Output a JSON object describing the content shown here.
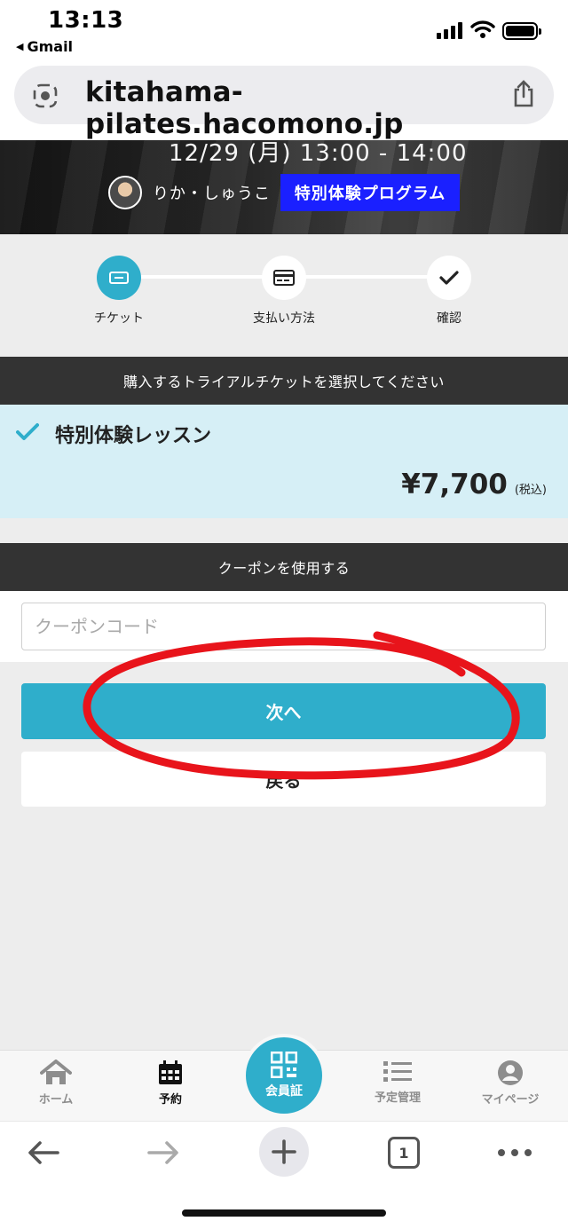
{
  "status_bar": {
    "time": "13:13",
    "back_app": "Gmail"
  },
  "browser": {
    "url": "kitahama-pilates.hacomono.jp",
    "tab_count": "1"
  },
  "lesson": {
    "datetime": "12/29 (月) 13:00 - 14:00",
    "instructor": "りか・しゅうこ",
    "program_badge": "特別体験プログラム"
  },
  "steps": [
    {
      "label": "チケット",
      "icon": "ticket-icon",
      "active": true
    },
    {
      "label": "支払い方法",
      "icon": "credit-card-icon",
      "active": false
    },
    {
      "label": "確認",
      "icon": "check-icon",
      "active": false
    }
  ],
  "ticket_section": {
    "header": "購入するトライアルチケットを選択してください",
    "ticket_name": "特別体験レッスン",
    "price": "¥7,700",
    "tax_note": "(税込)"
  },
  "coupon_section": {
    "header": "クーポンを使用する",
    "placeholder": "クーポンコード",
    "value": ""
  },
  "actions": {
    "next_label": "次へ",
    "back_label": "戻る"
  },
  "tab_bar": {
    "home": "ホーム",
    "reserve": "予約",
    "member_card": "会員証",
    "schedule": "予定管理",
    "mypage": "マイページ"
  },
  "colors": {
    "accent": "#2faecb",
    "badge_blue": "#1a20ff",
    "header_dark": "#333333",
    "ticket_bg": "#d6eff6",
    "annotation_red": "#e8141b"
  }
}
